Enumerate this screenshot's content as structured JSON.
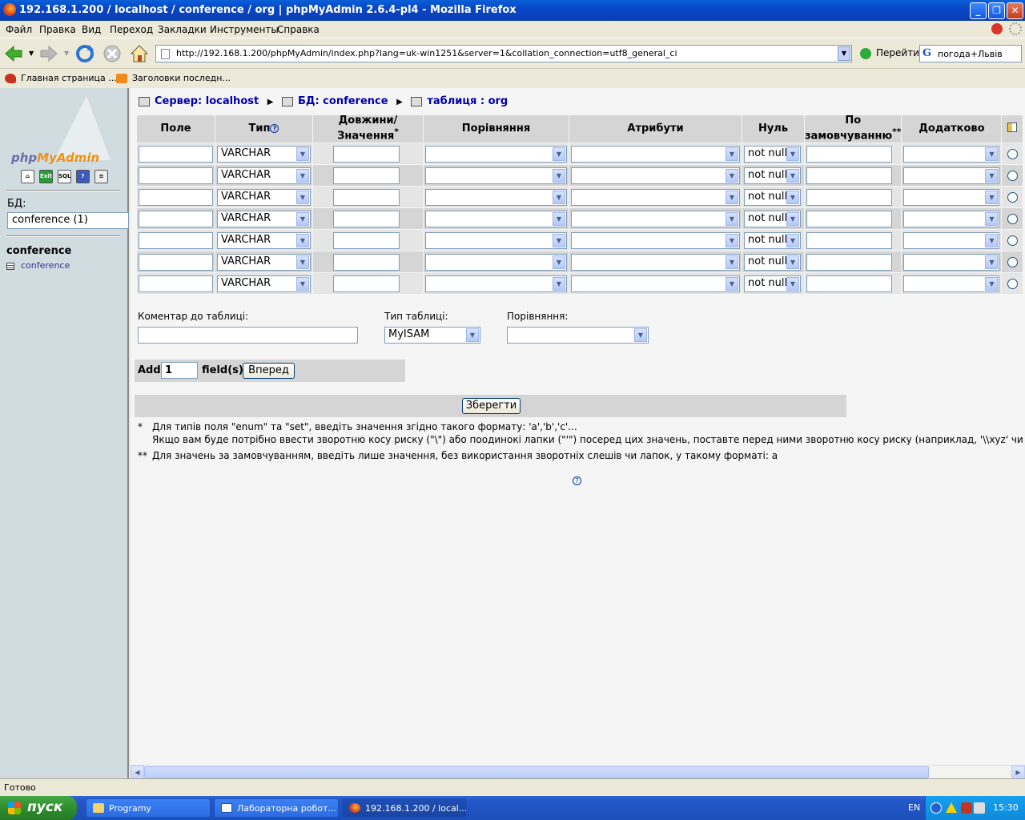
{
  "window": {
    "title": "192.168.1.200 / localhost / conference  / org | phpMyAdmin 2.6.4-pl4 - Mozilla Firefox"
  },
  "menu": [
    "Файл",
    "Правка",
    "Вид",
    "Переход",
    "Закладки",
    "Инструменты",
    "Справка"
  ],
  "nav": {
    "url": "http://192.168.1.200/phpMyAdmin/index.php?lang=uk-win1251&server=1&collation_connection=utf8_general_ci",
    "go_label": "Перейти",
    "search_value": "погода+Львів"
  },
  "bookmarks": [
    "Главная страница ...",
    "Заголовки последн..."
  ],
  "left": {
    "logo_php": "php",
    "logo_myadmin": "MyAdmin",
    "db_label": "БД:",
    "db_select": "conference (1)",
    "db_name": "conference",
    "tables": [
      "conference"
    ]
  },
  "breadcrumb": {
    "server": "Сервер: localhost",
    "db": "БД: conference",
    "table": "таблиця : org"
  },
  "columns": {
    "field": "Поле",
    "type": "Тип",
    "length": "Довжини/Значення",
    "length_mark": "*",
    "collation": "Порівняння",
    "attributes": "Атрибути",
    "null": "Нуль",
    "default": "По замовчуванню",
    "default_mark": "**",
    "extra": "Додатково"
  },
  "row_defaults": {
    "type": "VARCHAR",
    "null": "not null"
  },
  "rows": [
    {
      "field": "",
      "type": "VARCHAR",
      "length": "",
      "null": "not null",
      "default": ""
    },
    {
      "field": "",
      "type": "VARCHAR",
      "length": "",
      "null": "not null",
      "default": ""
    },
    {
      "field": "",
      "type": "VARCHAR",
      "length": "",
      "null": "not null",
      "default": ""
    },
    {
      "field": "",
      "type": "VARCHAR",
      "length": "",
      "null": "not null",
      "default": ""
    },
    {
      "field": "",
      "type": "VARCHAR",
      "length": "",
      "null": "not null",
      "default": ""
    },
    {
      "field": "",
      "type": "VARCHAR",
      "length": "",
      "null": "not null",
      "default": ""
    },
    {
      "field": "",
      "type": "VARCHAR",
      "length": "",
      "null": "not null",
      "default": ""
    }
  ],
  "table_options": {
    "comment_label": "Коментар до таблиці:",
    "type_label": "Тип таблиці:",
    "type_value": "MyISAM",
    "collation_label": "Порівняння:"
  },
  "add": {
    "label": "Add",
    "value": "1",
    "suffix": "field(s)",
    "button": "Вперед"
  },
  "save_button": "Зберегти",
  "notes": {
    "star1": "*",
    "line1": "Для типів поля \"enum\" та \"set\", введіть значення згідно такого формату: 'a','b','c'...",
    "line2": "Якщо вам буде потрібно ввести зворотню косу риску (\"\\\") або поодинокі лапки (\"'\") посеред цих значень, поставте перед ними зворотню косу риску (наприклад, '\\\\xyz' чи 'a\\'b').",
    "star2": "**",
    "line3": "Для значень за замовчуванням, введіть лише значення, без використання зворотніх слешів чи лапок, у такому форматі: a"
  },
  "status": "Готово",
  "taskbar": {
    "start": "пуск",
    "items": [
      "Programy",
      "Лабораторна робот...",
      "192.168.1.200 / local..."
    ],
    "lang": "EN",
    "clock": "15:30"
  }
}
